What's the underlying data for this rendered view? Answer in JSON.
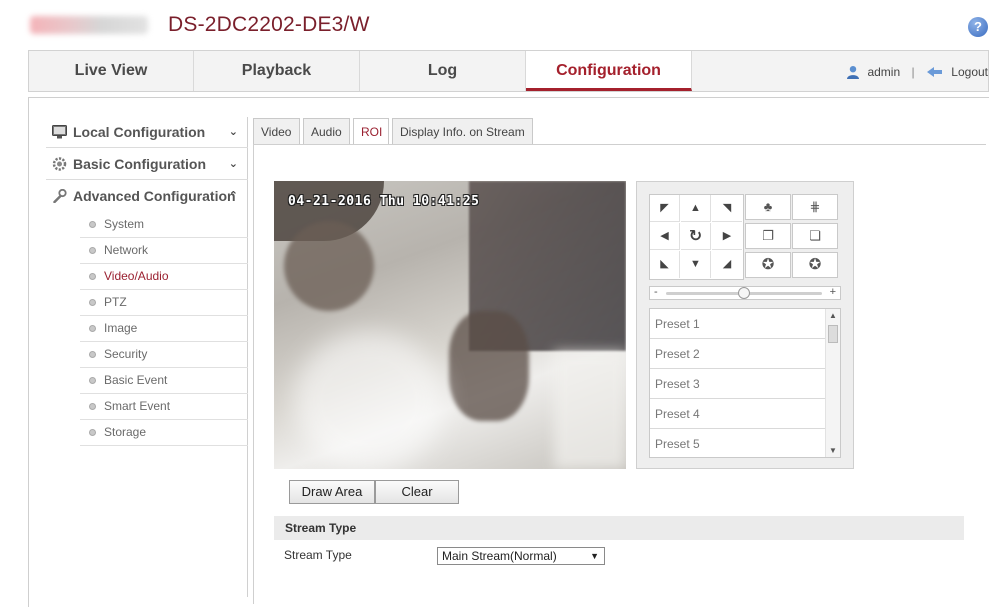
{
  "header": {
    "model": "DS-2DC2202-DE3/W",
    "help_label": "?"
  },
  "nav": {
    "tabs": [
      {
        "label": "Live View"
      },
      {
        "label": "Playback"
      },
      {
        "label": "Log"
      },
      {
        "label": "Configuration",
        "active": true
      }
    ],
    "user": "admin",
    "separator": "|",
    "logout": "Logout"
  },
  "sidebar": {
    "sections": [
      {
        "label": "Local Configuration",
        "icon": "monitor-icon",
        "chevron": "⌄"
      },
      {
        "label": "Basic Configuration",
        "icon": "gear-icon",
        "chevron": "⌄"
      },
      {
        "label": "Advanced Configuration",
        "icon": "wrench-icon",
        "chevron": "⌃"
      }
    ],
    "items": [
      {
        "label": "System"
      },
      {
        "label": "Network"
      },
      {
        "label": "Video/Audio",
        "active": true
      },
      {
        "label": "PTZ"
      },
      {
        "label": "Image"
      },
      {
        "label": "Security"
      },
      {
        "label": "Basic Event"
      },
      {
        "label": "Smart Event"
      },
      {
        "label": "Storage"
      }
    ]
  },
  "subtabs": [
    {
      "label": "Video"
    },
    {
      "label": "Audio"
    },
    {
      "label": "ROI",
      "active": true
    },
    {
      "label": "Display Info. on Stream"
    }
  ],
  "video": {
    "osd": "04-21-2016 Thu 10:41:25"
  },
  "ptz": {
    "presets": [
      "Preset 1",
      "Preset 2",
      "Preset 3",
      "Preset 4",
      "Preset 5"
    ],
    "speed_minus": "-",
    "speed_plus": "+",
    "speed_level": 0.5
  },
  "buttons": {
    "draw_area": "Draw Area",
    "clear": "Clear"
  },
  "stream": {
    "section_title": "Stream Type",
    "label": "Stream Type",
    "value": "Main Stream(Normal)"
  },
  "colors": {
    "accent": "#a4202c",
    "active_text": "#9a2030"
  }
}
